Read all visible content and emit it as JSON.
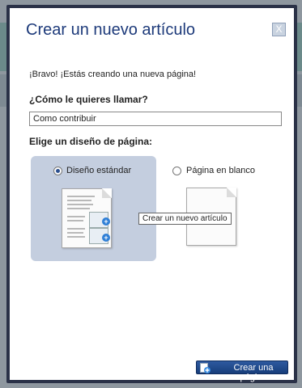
{
  "dialog": {
    "title": "Crear un nuevo artículo",
    "close_label": "X",
    "intro": "¡Bravo! ¡Estás creando una nueva página!",
    "name_label": "¿Cómo le quieres llamar?",
    "name_value": "Como contribuir",
    "layout_label": "Elige un diseño de página:",
    "options": [
      {
        "label": "Diseño estándar",
        "selected": true
      },
      {
        "label": "Página en blanco",
        "selected": false
      }
    ],
    "tooltip": "Crear un nuevo artículo",
    "submit_label": "Crear una página"
  },
  "colors": {
    "title": "#1d3a7a",
    "selected_option_bg": "#c4cedf",
    "button": "#173d7a",
    "border": "#2a3147"
  }
}
